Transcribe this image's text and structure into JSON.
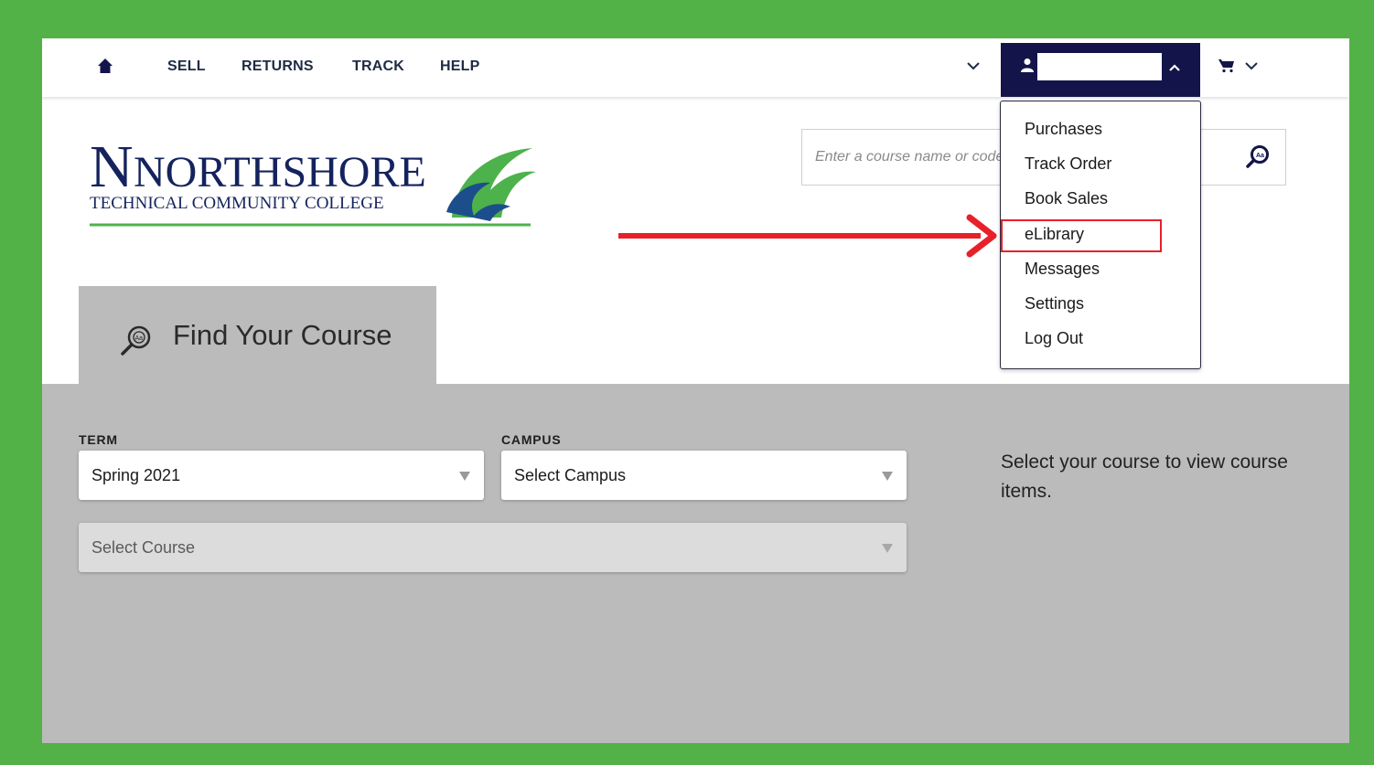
{
  "nav": {
    "links": [
      "SELL",
      "RETURNS",
      "TRACK",
      "HELP"
    ]
  },
  "logo": {
    "name": "NORTHSHORE",
    "subtitle": "TECHNICAL COMMUNITY COLLEGE"
  },
  "search": {
    "placeholder": "Enter a course name or code"
  },
  "account_menu": {
    "items": [
      "Purchases",
      "Track Order",
      "Book Sales",
      "eLibrary",
      "Messages",
      "Settings",
      "Log Out"
    ],
    "highlighted": "eLibrary"
  },
  "find_course": {
    "title": "Find Your Course",
    "term_label": "TERM",
    "term_value": "Spring 2021",
    "campus_label": "CAMPUS",
    "campus_value": "Select Campus",
    "course_value": "Select Course",
    "helper": "Select your course to view course items."
  },
  "colors": {
    "frame_border": "#52b247",
    "account_button": "#13154a",
    "panel_gray": "#bbbbbb",
    "annotation_red": "#e8202a",
    "logo_navy": "#14235e",
    "logo_green": "#4db24b"
  }
}
